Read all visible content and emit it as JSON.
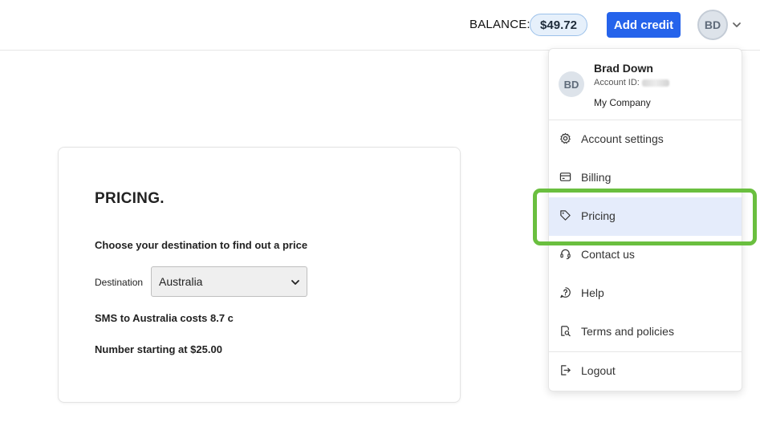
{
  "topbar": {
    "balance_label": "BALANCE:",
    "balance_value": "$49.72",
    "add_credit_label": "Add credit",
    "avatar_initials": "BD",
    "menu_chevron_icon": "chevron-down-icon"
  },
  "pricing": {
    "title": "PRICING.",
    "subtitle": "Choose your destination to find out a price",
    "destination_label": "Destination",
    "destination_selected": "Australia",
    "sms_cost_text": "SMS to Australia costs 8.7 c",
    "number_cost_text": "Number starting at $25.00"
  },
  "user_menu": {
    "avatar_initials": "BD",
    "user_name": "Brad Down",
    "account_id_label": "Account ID:",
    "company": "My Company",
    "items": [
      {
        "label": "Account settings",
        "icon": "gear-icon"
      },
      {
        "label": "Billing",
        "icon": "credit-card-icon"
      },
      {
        "label": "Pricing",
        "icon": "price-tag-icon",
        "active": true
      },
      {
        "label": "Contact us",
        "icon": "headset-icon"
      },
      {
        "label": "Help",
        "icon": "help-icon"
      },
      {
        "label": "Terms and policies",
        "icon": "document-search-icon"
      },
      {
        "label": "Logout",
        "icon": "logout-icon"
      }
    ]
  },
  "colors": {
    "primary": "#2563eb",
    "highlight": "#6abf3f",
    "active_item_bg": "#e5ecfb",
    "balance_pill_bg": "#e6f0fb"
  }
}
